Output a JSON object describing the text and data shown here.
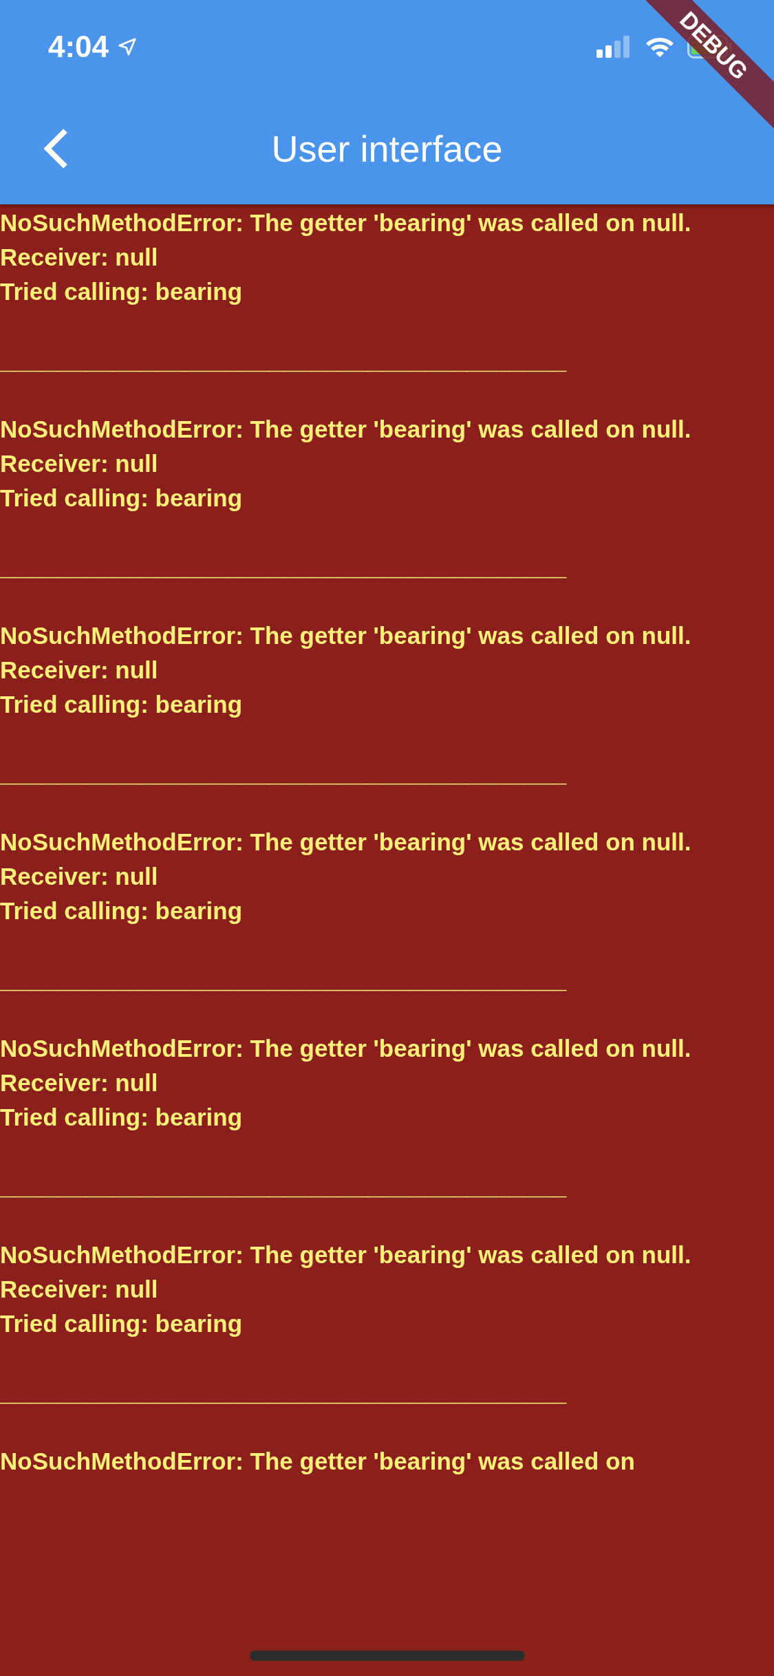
{
  "status_bar": {
    "time": "4:04"
  },
  "app_bar": {
    "title": "User interface"
  },
  "debug_banner": {
    "label": "DEBUG"
  },
  "error_log": [
    {
      "lines": [
        "NoSuchMethodError: The getter 'bearing' was called on null.",
        "Receiver: null",
        "Tried calling: bearing"
      ],
      "separator": "________________________________________"
    },
    {
      "lines": [
        "NoSuchMethodError: The getter 'bearing' was called on null.",
        "Receiver: null",
        "Tried calling: bearing"
      ],
      "separator": "________________________________________"
    },
    {
      "lines": [
        "NoSuchMethodError: The getter 'bearing' was called on null.",
        "Receiver: null",
        "Tried calling: bearing"
      ],
      "separator": "________________________________________"
    },
    {
      "lines": [
        "NoSuchMethodError: The getter 'bearing' was called on null.",
        "Receiver: null",
        "Tried calling: bearing"
      ],
      "separator": "________________________________________"
    },
    {
      "lines": [
        "NoSuchMethodError: The getter 'bearing' was called on null.",
        "Receiver: null",
        "Tried calling: bearing"
      ],
      "separator": "________________________________________"
    },
    {
      "lines": [
        "NoSuchMethodError: The getter 'bearing' was called on null.",
        "Receiver: null",
        "Tried calling: bearing"
      ],
      "separator": "________________________________________"
    },
    {
      "lines": [
        "NoSuchMethodError: The getter 'bearing' was called on"
      ]
    }
  ]
}
